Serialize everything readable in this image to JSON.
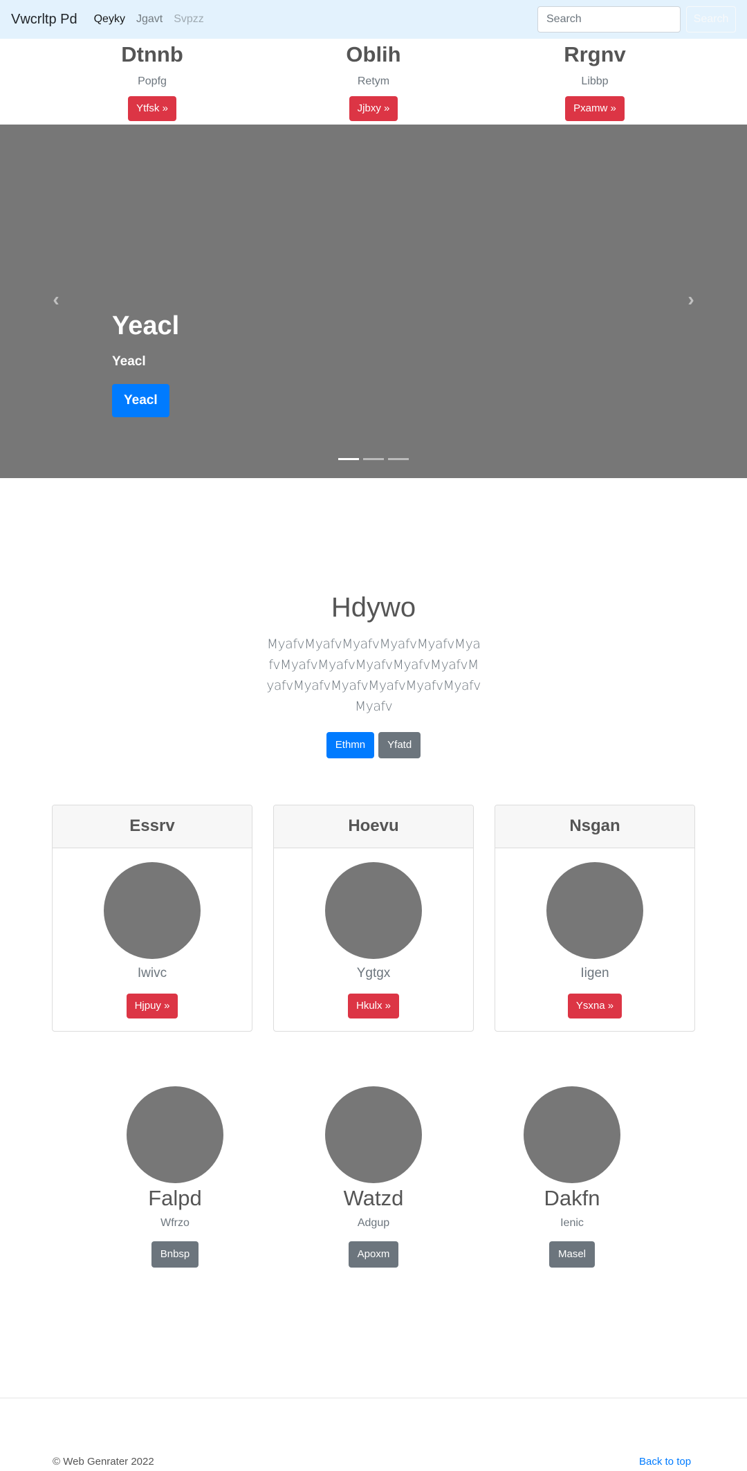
{
  "navbar": {
    "brand": "Vwcrltp Pd",
    "links": [
      {
        "label": "Qeyky",
        "state": "active"
      },
      {
        "label": "Jgavt",
        "state": "normal"
      },
      {
        "label": "Svpzz",
        "state": "disabled"
      }
    ],
    "search_placeholder": "Search",
    "search_button": "Search"
  },
  "top_strip": [
    {
      "title": "Dtnnb",
      "text": "Popfg",
      "button": "Ytfsk »"
    },
    {
      "title": "Oblih",
      "text": "Retym",
      "button": "Jjbxy »"
    },
    {
      "title": "Rrgnv",
      "text": "Libbp",
      "button": "Pxamw »"
    }
  ],
  "carousel": {
    "prev_icon": "‹",
    "next_icon": "›",
    "title": "Yeacl",
    "subtitle": "Yeacl",
    "button": "Yeacl",
    "slide_count": 3,
    "active_slide": 1
  },
  "jumbo": {
    "title": "Hdywo",
    "lead": "MyafvMyafvMyafvMyafvMyafvMyafvMyafvMyafvMyafvMyafvMyafvMyafvMyafvMyafvMyafvMyafvMyafvMyafv",
    "primary_button": "Ethmn",
    "secondary_button": "Yfatd"
  },
  "cards": [
    {
      "header": "Essrv",
      "text": "Iwivc",
      "button": "Hjpuy »"
    },
    {
      "header": "Hoevu",
      "text": "Ygtgx",
      "button": "Hkulx »"
    },
    {
      "header": "Nsgan",
      "text": "Iigen",
      "button": "Ysxna »"
    }
  ],
  "features": [
    {
      "title": "Falpd",
      "text": "Wfrzo",
      "button": "Bnbsp"
    },
    {
      "title": "Watzd",
      "text": "Adgup",
      "button": "Apoxm"
    },
    {
      "title": "Dakfn",
      "text": "Ienic",
      "button": "Masel"
    }
  ],
  "footer": {
    "copyright": "© Web Genrater 2022",
    "back_to_top": "Back to top"
  },
  "colors": {
    "navbar_bg": "#e3f2fd",
    "danger": "#dc3545",
    "primary": "#007bff",
    "secondary": "#6c757d",
    "placeholder_gray": "#777777"
  }
}
